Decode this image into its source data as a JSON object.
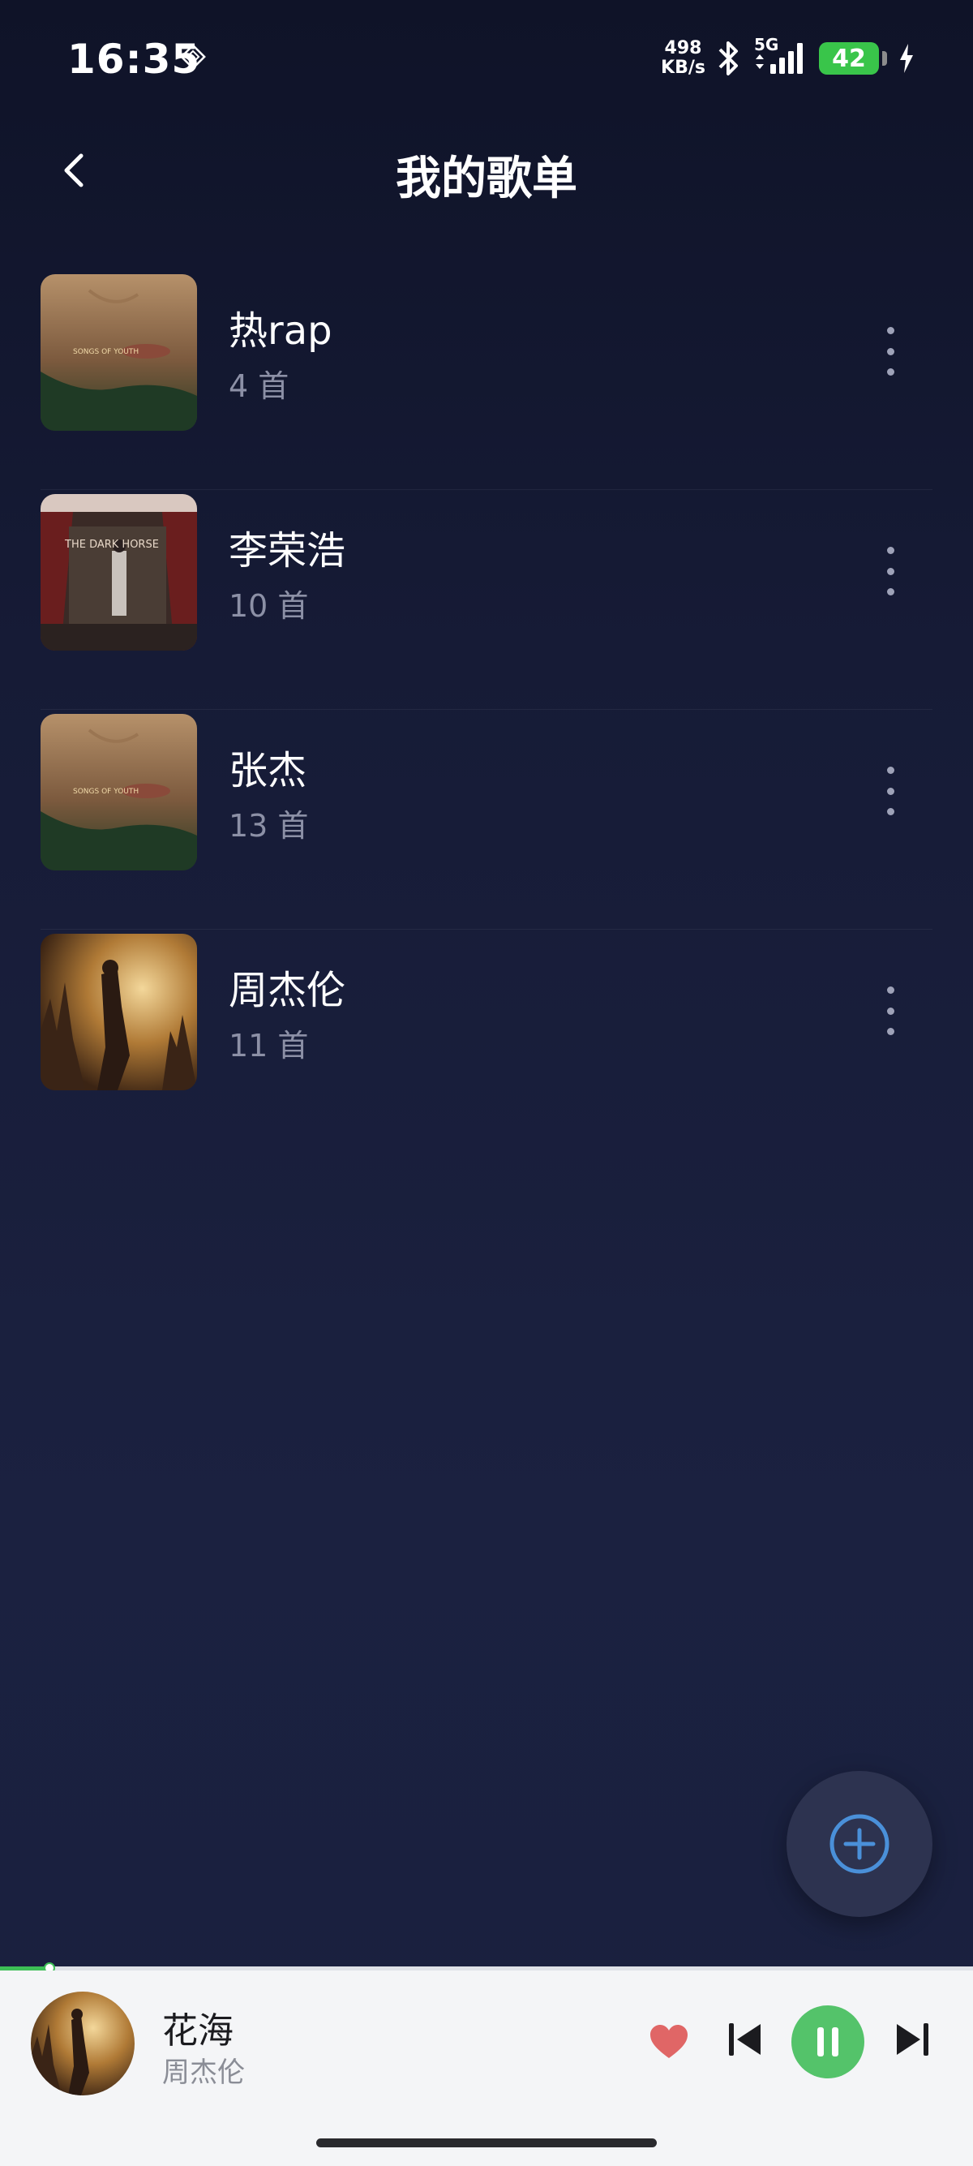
{
  "status_bar": {
    "time": "16:35",
    "net_speed_value": "498",
    "net_speed_unit": "KB/s",
    "network": "5G",
    "battery": "42"
  },
  "header": {
    "title": "我的歌单",
    "back_icon": "chevron-left-icon"
  },
  "playlists": [
    {
      "name": "热rap",
      "count": "4 首",
      "cover_text": "SONGS OF YOUTH"
    },
    {
      "name": "李荣浩",
      "count": "10 首",
      "cover_text": "THE DARK HORSE"
    },
    {
      "name": "张杰",
      "count": "13 首",
      "cover_text": "SONGS OF YOUTH"
    },
    {
      "name": "周杰伦",
      "count": "11 首",
      "cover_text": ""
    }
  ],
  "fab": {
    "icon": "plus-circle-icon"
  },
  "player": {
    "title": "花海",
    "artist": "周杰伦",
    "progress": 0.05,
    "liked": true,
    "state": "playing"
  },
  "colors": {
    "accent_green": "#54c36a",
    "heart": "#e06666",
    "fab_icon": "#4a90d9"
  }
}
